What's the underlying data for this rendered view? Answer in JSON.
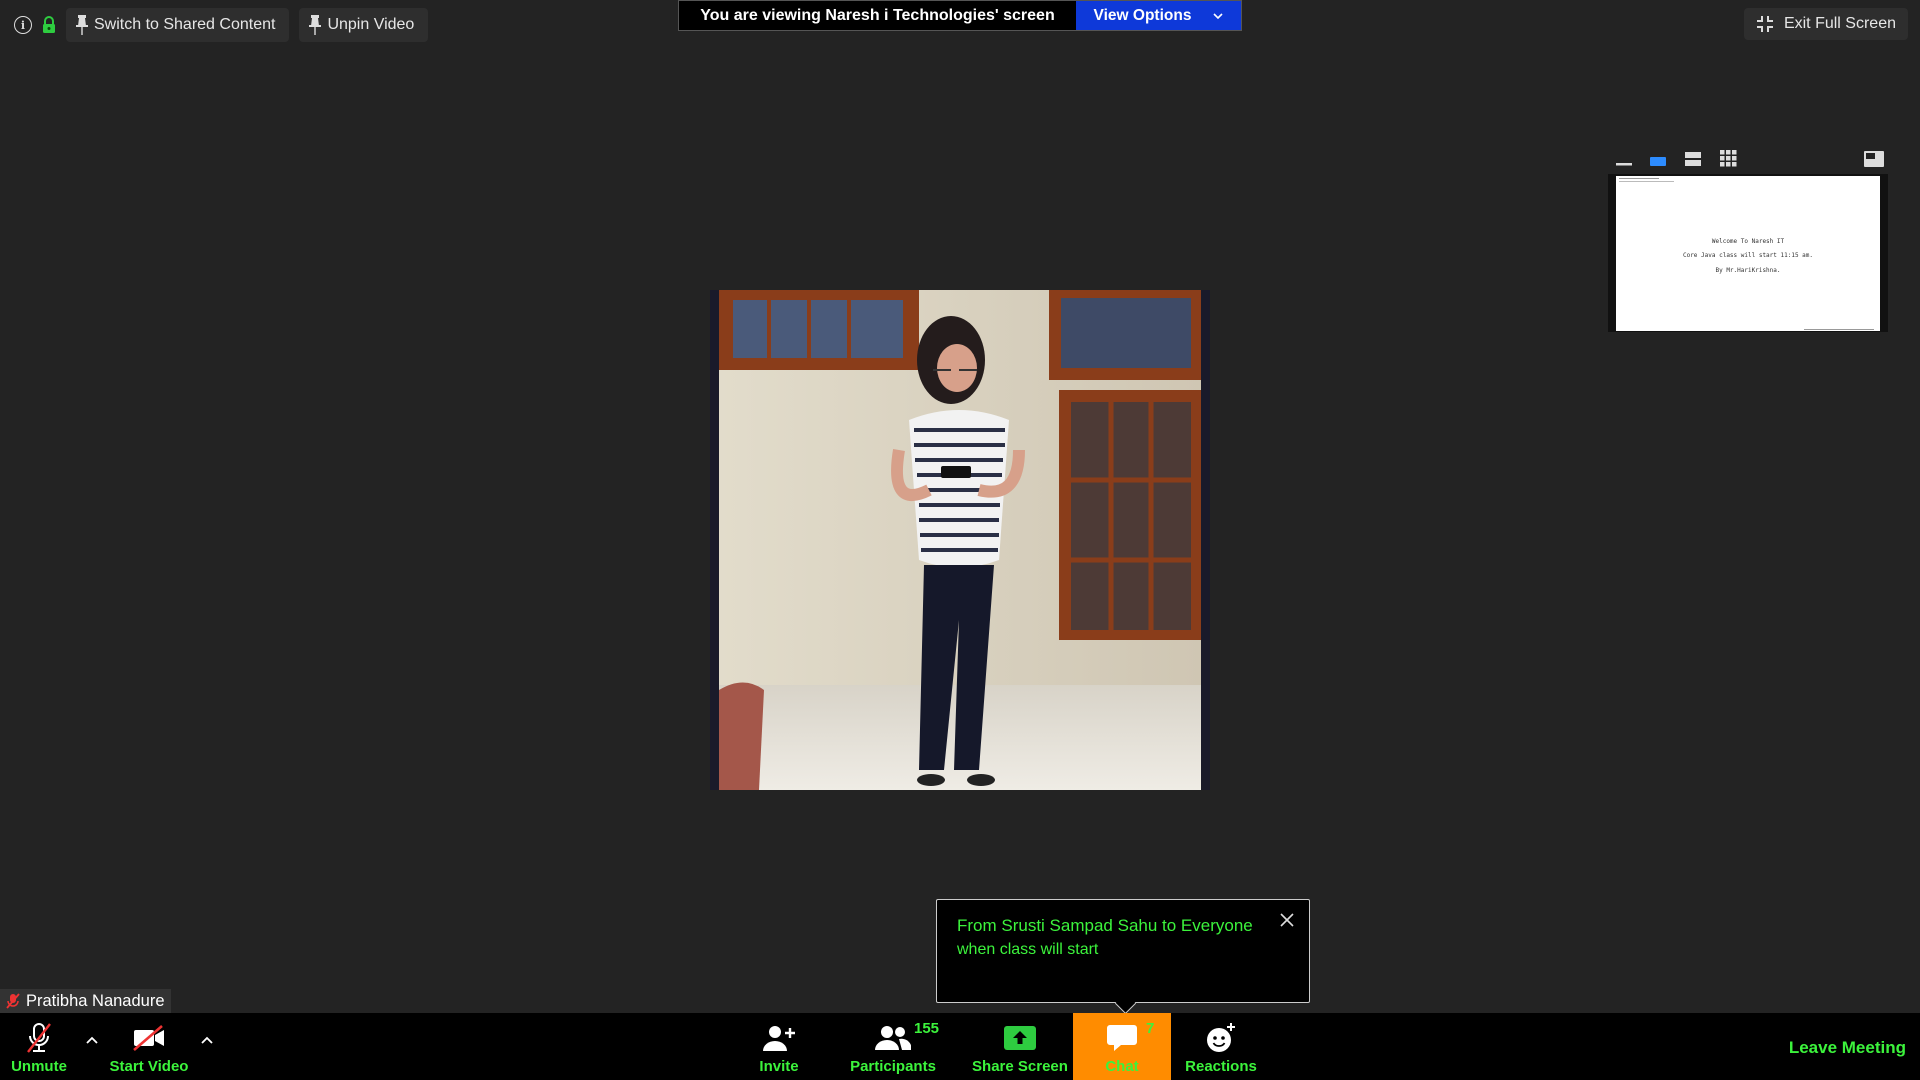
{
  "top_left": {
    "info_icon": "info-icon",
    "lock_icon": "lock-icon",
    "switch_label": "Switch to Shared Content",
    "unpin_label": "Unpin Video"
  },
  "banner": {
    "viewing_text": "You are viewing Naresh i Technologies' screen",
    "view_options_label": "View Options"
  },
  "top_right": {
    "exit_fullscreen_label": "Exit Full Screen"
  },
  "thumbnail": {
    "lines": [
      "Welcome To Naresh IT",
      "Core Java class will start 11:15 am.",
      "By Mr.HariKrishna."
    ]
  },
  "name_tag": {
    "name": "Pratibha Nanadure"
  },
  "chat_popup": {
    "from": "From Srusti Sampad Sahu to Everyone",
    "message": "when class will start"
  },
  "toolbar": {
    "unmute_label": "Unmute",
    "start_video_label": "Start Video",
    "invite_label": "Invite",
    "participants_label": "Participants",
    "participants_count": "155",
    "share_screen_label": "Share Screen",
    "chat_label": "Chat",
    "chat_count": "7",
    "reactions_label": "Reactions",
    "leave_label": "Leave Meeting"
  },
  "colors": {
    "accent_green": "#3cf33c",
    "chat_active": "#ff8c00",
    "banner_blue": "#0e39d9",
    "background": "#232323"
  }
}
